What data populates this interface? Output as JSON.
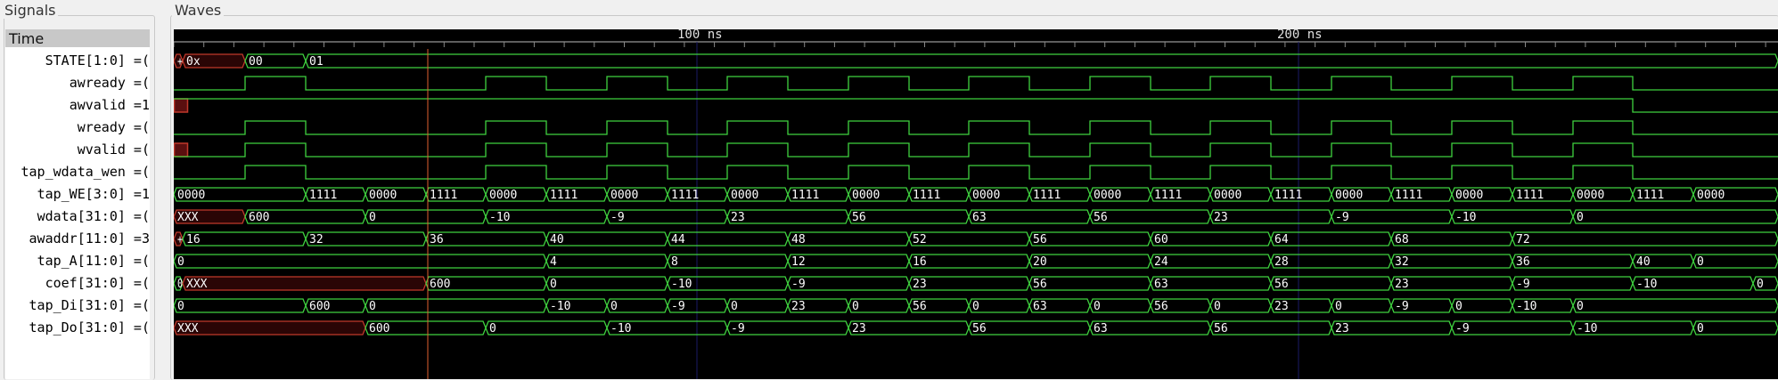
{
  "signals_panel": {
    "title": "Signals",
    "time_label": "Time"
  },
  "waves_panel": {
    "title": "Waves"
  },
  "timeline": {
    "markers": [
      "100 ns",
      "200 ns"
    ]
  },
  "signals": [
    {
      "name": "STATE[1:0] =("
    },
    {
      "name": "awready =("
    },
    {
      "name": "awvalid =1"
    },
    {
      "name": "wready =("
    },
    {
      "name": "wvalid =("
    },
    {
      "name": "tap_wdata_wen =("
    },
    {
      "name": "tap_WE[3:0] =1"
    },
    {
      "name": "wdata[31:0] =("
    },
    {
      "name": "awaddr[11:0] =3"
    },
    {
      "name": "tap_A[11:0] =("
    },
    {
      "name": "coef[31:0] =("
    },
    {
      "name": "tap_Di[31:0] =("
    },
    {
      "name": "tap_Do[31:0] =("
    }
  ],
  "waves": [
    {
      "type": "bus",
      "segs": [
        [
          0,
          10,
          "+",
          1
        ],
        [
          10,
          80,
          "0x",
          1
        ],
        [
          80,
          148,
          "00",
          0
        ],
        [
          148,
          1800,
          "01",
          0
        ]
      ]
    },
    {
      "type": "bit",
      "edges": [
        [
          0,
          0
        ],
        [
          80,
          1
        ],
        [
          148,
          0
        ],
        [
          350,
          1
        ],
        [
          418,
          0
        ],
        [
          486,
          1
        ],
        [
          554,
          0
        ],
        [
          621,
          1
        ],
        [
          689,
          0
        ],
        [
          757,
          1
        ],
        [
          825,
          0
        ],
        [
          892,
          1
        ],
        [
          960,
          0
        ],
        [
          1028,
          1
        ],
        [
          1096,
          0
        ],
        [
          1163,
          1
        ],
        [
          1231,
          0
        ],
        [
          1299,
          1
        ],
        [
          1366,
          0
        ],
        [
          1434,
          1
        ],
        [
          1502,
          0
        ],
        [
          1570,
          1
        ],
        [
          1637,
          0
        ]
      ]
    },
    {
      "type": "bit",
      "red": [
        0,
        15
      ],
      "edges": [
        [
          0,
          1
        ],
        [
          1637,
          0
        ]
      ]
    },
    {
      "type": "bit",
      "edges": [
        [
          0,
          0
        ],
        [
          80,
          1
        ],
        [
          148,
          0
        ],
        [
          350,
          1
        ],
        [
          418,
          0
        ],
        [
          486,
          1
        ],
        [
          554,
          0
        ],
        [
          621,
          1
        ],
        [
          689,
          0
        ],
        [
          757,
          1
        ],
        [
          825,
          0
        ],
        [
          892,
          1
        ],
        [
          960,
          0
        ],
        [
          1028,
          1
        ],
        [
          1096,
          0
        ],
        [
          1163,
          1
        ],
        [
          1231,
          0
        ],
        [
          1299,
          1
        ],
        [
          1366,
          0
        ],
        [
          1434,
          1
        ],
        [
          1502,
          0
        ],
        [
          1570,
          1
        ],
        [
          1637,
          0
        ]
      ]
    },
    {
      "type": "bit",
      "red": [
        0,
        15
      ],
      "edges": [
        [
          0,
          0
        ],
        [
          80,
          1
        ],
        [
          148,
          0
        ],
        [
          350,
          1
        ],
        [
          418,
          0
        ],
        [
          486,
          1
        ],
        [
          554,
          0
        ],
        [
          621,
          1
        ],
        [
          689,
          0
        ],
        [
          757,
          1
        ],
        [
          825,
          0
        ],
        [
          892,
          1
        ],
        [
          960,
          0
        ],
        [
          1028,
          1
        ],
        [
          1096,
          0
        ],
        [
          1163,
          1
        ],
        [
          1231,
          0
        ],
        [
          1299,
          1
        ],
        [
          1366,
          0
        ],
        [
          1434,
          1
        ],
        [
          1502,
          0
        ],
        [
          1570,
          1
        ],
        [
          1637,
          0
        ]
      ]
    },
    {
      "type": "bit",
      "edges": [
        [
          0,
          0
        ],
        [
          80,
          1
        ],
        [
          148,
          0
        ],
        [
          350,
          1
        ],
        [
          418,
          0
        ],
        [
          486,
          1
        ],
        [
          554,
          0
        ],
        [
          621,
          1
        ],
        [
          689,
          0
        ],
        [
          757,
          1
        ],
        [
          825,
          0
        ],
        [
          892,
          1
        ],
        [
          960,
          0
        ],
        [
          1028,
          1
        ],
        [
          1096,
          0
        ],
        [
          1163,
          1
        ],
        [
          1231,
          0
        ],
        [
          1299,
          1
        ],
        [
          1366,
          0
        ],
        [
          1434,
          1
        ],
        [
          1502,
          0
        ],
        [
          1570,
          1
        ],
        [
          1637,
          0
        ]
      ]
    },
    {
      "type": "bus",
      "segs": [
        [
          0,
          148,
          "0000",
          0
        ],
        [
          148,
          215,
          "1111",
          0
        ],
        [
          215,
          283,
          "0000",
          0
        ],
        [
          283,
          350,
          "1111",
          0
        ],
        [
          350,
          418,
          "0000",
          0
        ],
        [
          418,
          486,
          "1111",
          0
        ],
        [
          486,
          554,
          "0000",
          0
        ],
        [
          554,
          621,
          "1111",
          0
        ],
        [
          621,
          689,
          "0000",
          0
        ],
        [
          689,
          757,
          "1111",
          0
        ],
        [
          757,
          825,
          "0000",
          0
        ],
        [
          825,
          892,
          "1111",
          0
        ],
        [
          892,
          960,
          "0000",
          0
        ],
        [
          960,
          1028,
          "1111",
          0
        ],
        [
          1028,
          1096,
          "0000",
          0
        ],
        [
          1096,
          1163,
          "1111",
          0
        ],
        [
          1163,
          1231,
          "0000",
          0
        ],
        [
          1231,
          1299,
          "1111",
          0
        ],
        [
          1299,
          1366,
          "0000",
          0
        ],
        [
          1366,
          1434,
          "1111",
          0
        ],
        [
          1434,
          1502,
          "0000",
          0
        ],
        [
          1502,
          1570,
          "1111",
          0
        ],
        [
          1570,
          1637,
          "0000",
          0
        ],
        [
          1637,
          1705,
          "1111",
          0
        ],
        [
          1705,
          1800,
          "0000",
          0
        ]
      ]
    },
    {
      "type": "bus",
      "segs": [
        [
          0,
          80,
          "XXX",
          1
        ],
        [
          80,
          215,
          "600",
          0
        ],
        [
          215,
          350,
          "0",
          0
        ],
        [
          350,
          486,
          "-10",
          0
        ],
        [
          486,
          621,
          "-9",
          0
        ],
        [
          621,
          757,
          "23",
          0
        ],
        [
          757,
          892,
          "56",
          0
        ],
        [
          892,
          1028,
          "63",
          0
        ],
        [
          1028,
          1163,
          "56",
          0
        ],
        [
          1163,
          1299,
          "23",
          0
        ],
        [
          1299,
          1434,
          "-9",
          0
        ],
        [
          1434,
          1570,
          "-10",
          0
        ],
        [
          1570,
          1800,
          "0",
          0
        ]
      ]
    },
    {
      "type": "bus",
      "segs": [
        [
          0,
          10,
          "+",
          1
        ],
        [
          10,
          148,
          "16",
          0
        ],
        [
          148,
          283,
          "32",
          0
        ],
        [
          283,
          418,
          "36",
          0
        ],
        [
          418,
          554,
          "40",
          0
        ],
        [
          554,
          689,
          "44",
          0
        ],
        [
          689,
          825,
          "48",
          0
        ],
        [
          825,
          960,
          "52",
          0
        ],
        [
          960,
          1096,
          "56",
          0
        ],
        [
          1096,
          1231,
          "60",
          0
        ],
        [
          1231,
          1366,
          "64",
          0
        ],
        [
          1366,
          1502,
          "68",
          0
        ],
        [
          1502,
          1800,
          "72",
          0
        ]
      ]
    },
    {
      "type": "bus",
      "segs": [
        [
          0,
          418,
          "0",
          0
        ],
        [
          418,
          554,
          "4",
          0
        ],
        [
          554,
          689,
          "8",
          0
        ],
        [
          689,
          825,
          "12",
          0
        ],
        [
          825,
          960,
          "16",
          0
        ],
        [
          960,
          1096,
          "20",
          0
        ],
        [
          1096,
          1231,
          "24",
          0
        ],
        [
          1231,
          1366,
          "28",
          0
        ],
        [
          1366,
          1502,
          "32",
          0
        ],
        [
          1502,
          1637,
          "36",
          0
        ],
        [
          1637,
          1705,
          "40",
          0
        ],
        [
          1705,
          1800,
          "0",
          0
        ]
      ]
    },
    {
      "type": "bus",
      "segs": [
        [
          0,
          10,
          "0",
          0
        ],
        [
          10,
          283,
          "XXX",
          1
        ],
        [
          283,
          418,
          "600",
          0
        ],
        [
          418,
          554,
          "0",
          0
        ],
        [
          554,
          689,
          "-10",
          0
        ],
        [
          689,
          825,
          "-9",
          0
        ],
        [
          825,
          960,
          "23",
          0
        ],
        [
          960,
          1096,
          "56",
          0
        ],
        [
          1096,
          1231,
          "63",
          0
        ],
        [
          1231,
          1366,
          "56",
          0
        ],
        [
          1366,
          1502,
          "23",
          0
        ],
        [
          1502,
          1637,
          "-9",
          0
        ],
        [
          1637,
          1772,
          "-10",
          0
        ],
        [
          1772,
          1800,
          "0",
          0
        ]
      ]
    },
    {
      "type": "bus",
      "segs": [
        [
          0,
          148,
          "0",
          0
        ],
        [
          148,
          215,
          "600",
          0
        ],
        [
          215,
          418,
          "0",
          0
        ],
        [
          418,
          486,
          "-10",
          0
        ],
        [
          486,
          554,
          "0",
          0
        ],
        [
          554,
          621,
          "-9",
          0
        ],
        [
          621,
          689,
          "0",
          0
        ],
        [
          689,
          757,
          "23",
          0
        ],
        [
          757,
          825,
          "0",
          0
        ],
        [
          825,
          892,
          "56",
          0
        ],
        [
          892,
          960,
          "0",
          0
        ],
        [
          960,
          1028,
          "63",
          0
        ],
        [
          1028,
          1096,
          "0",
          0
        ],
        [
          1096,
          1163,
          "56",
          0
        ],
        [
          1163,
          1231,
          "0",
          0
        ],
        [
          1231,
          1299,
          "23",
          0
        ],
        [
          1299,
          1366,
          "0",
          0
        ],
        [
          1366,
          1434,
          "-9",
          0
        ],
        [
          1434,
          1502,
          "0",
          0
        ],
        [
          1502,
          1570,
          "-10",
          0
        ],
        [
          1570,
          1800,
          "0",
          0
        ]
      ]
    },
    {
      "type": "bus",
      "segs": [
        [
          0,
          215,
          "XXX",
          1
        ],
        [
          215,
          350,
          "600",
          0
        ],
        [
          350,
          486,
          "0",
          0
        ],
        [
          486,
          621,
          "-10",
          0
        ],
        [
          621,
          757,
          "-9",
          0
        ],
        [
          757,
          892,
          "23",
          0
        ],
        [
          892,
          1028,
          "56",
          0
        ],
        [
          1028,
          1163,
          "63",
          0
        ],
        [
          1163,
          1299,
          "56",
          0
        ],
        [
          1299,
          1434,
          "23",
          0
        ],
        [
          1434,
          1570,
          "-9",
          0
        ],
        [
          1570,
          1705,
          "-10",
          0
        ],
        [
          1705,
          1800,
          "0",
          0
        ]
      ]
    }
  ],
  "colors": {
    "wave": "#3fd13f",
    "undefined": "#c0392b",
    "cursor": "#e06030",
    "grid": "#1a1a66",
    "background": "#000000",
    "ruler_text": "#e0e0e0"
  }
}
